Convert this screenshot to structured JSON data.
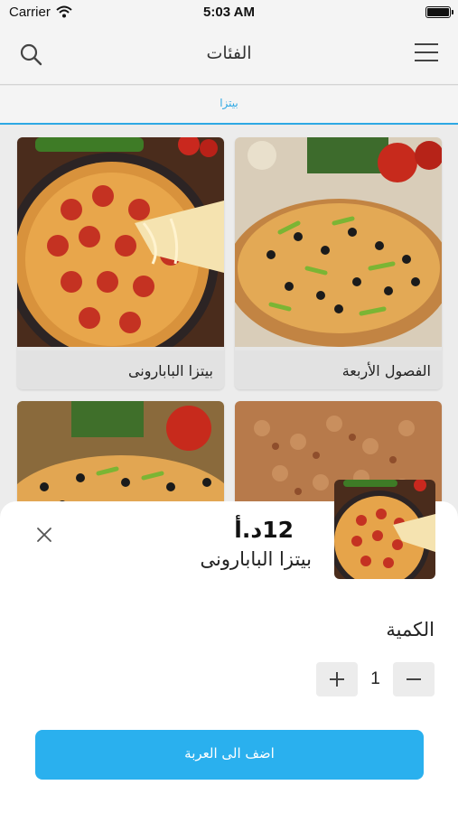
{
  "status_bar": {
    "carrier": "Carrier",
    "time": "5:03 AM"
  },
  "nav": {
    "title": "الفئات"
  },
  "tabs": [
    {
      "label": "بيتزا"
    }
  ],
  "grid": {
    "items": [
      {
        "label": "بيتزا البابارونى"
      },
      {
        "label": "الفصول الأربعة"
      },
      {
        "label": ""
      },
      {
        "label": ""
      }
    ]
  },
  "sheet": {
    "price": "12د.أ",
    "name": "بيتزا البابارونى",
    "quantity_label": "الكمية",
    "quantity": "1",
    "add_button_label": "اضف الى العربة"
  },
  "colors": {
    "accent": "#2ab0ee",
    "tab_active": "#2ea8e4"
  },
  "icons": {
    "search": "search-icon",
    "menu": "hamburger-menu-icon",
    "close": "close-icon",
    "plus": "plus-icon",
    "minus": "minus-icon"
  }
}
